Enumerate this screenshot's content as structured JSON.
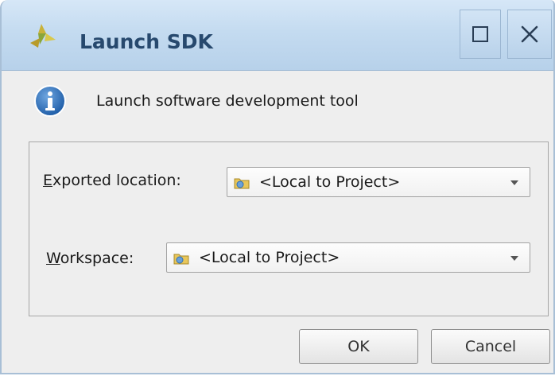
{
  "window": {
    "title": "Launch SDK",
    "icons": {
      "app": "xilinx-logo-icon",
      "maximize": "maximize-icon",
      "close": "close-icon"
    }
  },
  "message": {
    "icon": "info-icon",
    "text": "Launch software development tool"
  },
  "form": {
    "exported_location": {
      "label_mnemonic": "E",
      "label_rest": "xported location:",
      "value": "<Local to Project>",
      "icon": "folder-icon"
    },
    "workspace": {
      "label_mnemonic": "W",
      "label_rest": "orkspace:",
      "value": "<Local to Project>",
      "icon": "folder-icon"
    }
  },
  "buttons": {
    "ok_label": "OK",
    "cancel_label": "Cancel"
  },
  "colors": {
    "titlebar": "#c4dbf0",
    "title_text": "#27496e",
    "info_icon": "#2f6fb5"
  }
}
